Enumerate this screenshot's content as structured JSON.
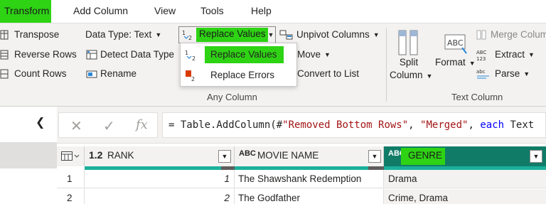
{
  "menu": {
    "tabs": [
      {
        "label": "Transform",
        "active": true
      },
      {
        "label": "Add Column",
        "active": false
      },
      {
        "label": "View",
        "active": false
      },
      {
        "label": "Tools",
        "active": false
      },
      {
        "label": "Help",
        "active": false
      }
    ]
  },
  "ribbon": {
    "table_group": {
      "transpose": "Transpose",
      "reverse_rows": "Reverse Rows",
      "count_rows": "Count Rows"
    },
    "any_column": {
      "data_type": "Data Type: Text",
      "detect_data_type": "Detect Data Type",
      "rename": "Rename",
      "replace_values": "Replace Values",
      "unpivot_columns": "Unpivot Columns",
      "move": "Move",
      "convert_to_list": "Convert to List",
      "group_label": "Any Column"
    },
    "text_column": {
      "split_column_line1": "Split",
      "split_column_line2": "Column",
      "format": "Format",
      "merge_columns": "Merge Colum",
      "extract": "Extract",
      "parse": "Parse",
      "group_label": "Text Column"
    }
  },
  "replace_dropdown": {
    "items": [
      {
        "label": "Replace Values",
        "highlighted": true
      },
      {
        "label": "Replace Errors",
        "highlighted": false
      }
    ]
  },
  "formula_bar": {
    "cancel_glyph": "✕",
    "commit_glyph": "✓",
    "fx_glyph": "fx",
    "prefix": "= Table.AddColumn(#",
    "string1": "\"Removed Bottom Rows\"",
    "sep": ", ",
    "string2": "\"Merged\"",
    "sep2": ", ",
    "keyword": "each",
    "suffix": " Text"
  },
  "grid": {
    "columns": [
      {
        "type": "1.2",
        "name": "RANK"
      },
      {
        "type": "ABC",
        "name": "MOVIE NAME"
      },
      {
        "type": "ABC",
        "name": "GENRE"
      }
    ],
    "rows": [
      {
        "index": "1",
        "rank": "1",
        "movie": "The Shawshank Redemption",
        "genre": "Drama"
      },
      {
        "index": "2",
        "rank": "2",
        "movie": "The Godfather",
        "genre": "Crime, Drama"
      }
    ]
  },
  "colors": {
    "highlight": "#2ed314",
    "genre_header": "#107c68",
    "quality_bar": "#1bb09b"
  }
}
